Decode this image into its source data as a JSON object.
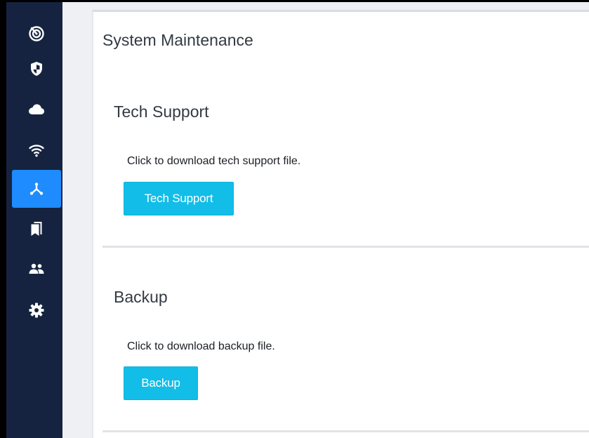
{
  "sidebar": {
    "items": [
      {
        "icon": "dashboard-icon",
        "active": false
      },
      {
        "icon": "shield-icon",
        "active": false
      },
      {
        "icon": "cloud-icon",
        "active": false
      },
      {
        "icon": "wifi-icon",
        "active": false
      },
      {
        "icon": "network-icon",
        "active": true
      },
      {
        "icon": "bookmarks-icon",
        "active": false
      },
      {
        "icon": "users-icon",
        "active": false
      },
      {
        "icon": "gear-icon",
        "active": false
      }
    ],
    "background": "#162340",
    "active_color": "#1e8bff"
  },
  "page": {
    "title": "System Maintenance"
  },
  "tech_support": {
    "title": "Tech Support",
    "description": "Click to download tech support file.",
    "button_label": "Tech Support"
  },
  "backup": {
    "title": "Backup",
    "description": "Click to download backup file.",
    "button_label": "Backup"
  },
  "colors": {
    "button": "#12bde8",
    "text": "#333a42"
  }
}
